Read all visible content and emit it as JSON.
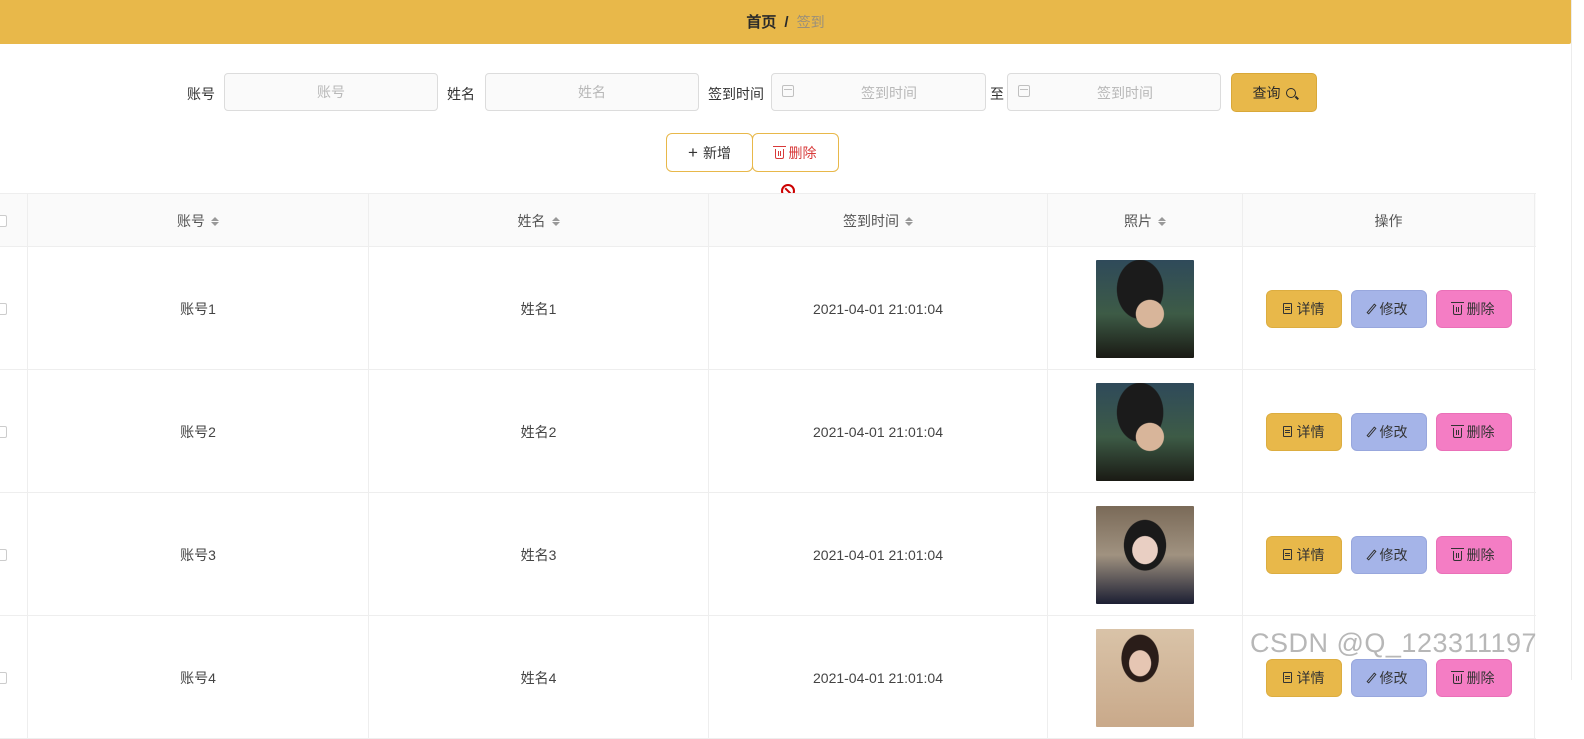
{
  "breadcrumb": {
    "home": "首页",
    "separator": "/",
    "current": "签到"
  },
  "search": {
    "account_label": "账号",
    "account_placeholder": "账号",
    "name_label": "姓名",
    "name_placeholder": "姓名",
    "time_label": "签到时间",
    "time_start_placeholder": "签到时间",
    "to_label": "至",
    "time_end_placeholder": "签到时间",
    "query_label": "查询"
  },
  "toolbar": {
    "add_label": "新增",
    "delete_label": "删除"
  },
  "table": {
    "headers": [
      "账号",
      "姓名",
      "签到时间",
      "照片",
      "操作"
    ],
    "rows": [
      {
        "account": "账号1",
        "name": "姓名1",
        "time": "2021-04-01 21:01:04"
      },
      {
        "account": "账号2",
        "name": "姓名2",
        "time": "2021-04-01 21:01:04"
      },
      {
        "account": "账号3",
        "name": "姓名3",
        "time": "2021-04-01 21:01:04"
      },
      {
        "account": "账号4",
        "name": "姓名4",
        "time": "2021-04-01 21:01:04"
      }
    ],
    "actions": {
      "detail": "详情",
      "edit": "修改",
      "delete": "删除"
    }
  },
  "watermark": "CSDN @Q_123311197",
  "colors": {
    "header": "#e8b84a",
    "detail_btn": "#e8b84a",
    "edit_btn": "#a5b4e8",
    "delete_btn": "#f47dc4"
  }
}
